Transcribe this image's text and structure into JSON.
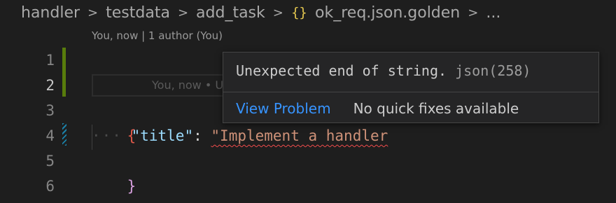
{
  "breadcrumb": {
    "items": [
      "handler",
      "testdata",
      "add_task"
    ],
    "file_icon": "{}",
    "file": "ok_req.json.golden",
    "overflow": "..."
  },
  "codelens": "You, now | 1 author (You)",
  "gutter": {
    "line_numbers": [
      "1",
      "2",
      "3",
      "4",
      "5",
      "6"
    ]
  },
  "editor": {
    "ghost_text": "You, now • Uncommitted changes",
    "line3": "{",
    "line4_indent": "···",
    "line4_key": "\"title\"",
    "line4_colon": ": ",
    "line4_string": "\"Implement a handler",
    "line5": "}"
  },
  "hover": {
    "message": "Unexpected end of string.",
    "source": "json(258)",
    "view_problem": "View Problem",
    "no_fixes": "No quick fixes available"
  },
  "colors": {
    "background": "#1e1e1e",
    "link": "#3794ff",
    "error_squiggle": "#f14c4c",
    "added_bar": "#587c0c",
    "modified_bar": "#1b81a8",
    "json_icon": "#e2c54f"
  }
}
